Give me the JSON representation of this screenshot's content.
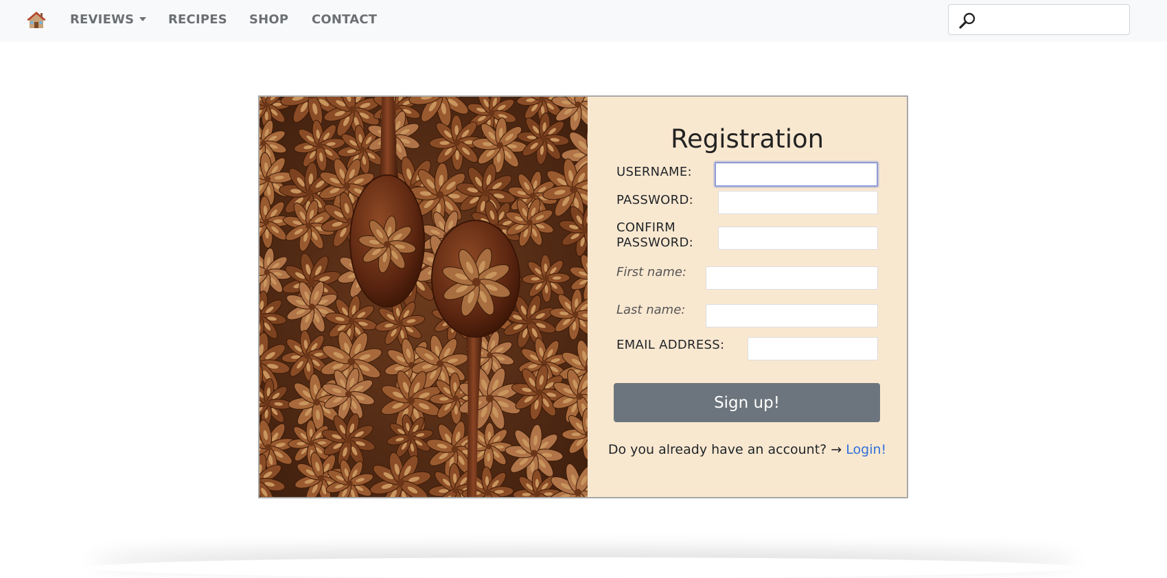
{
  "nav": {
    "home_icon": "house-icon",
    "items": [
      {
        "label": "REVIEWS",
        "has_dropdown": true
      },
      {
        "label": "RECIPES"
      },
      {
        "label": "SHOP"
      },
      {
        "label": "CONTACT"
      }
    ],
    "search": {
      "icon": "magnifier-icon",
      "value": "",
      "placeholder": ""
    }
  },
  "card": {
    "image": {
      "description_icon": "star-anise-photo"
    },
    "form": {
      "title": "Registration",
      "fields": {
        "username": {
          "label": "USERNAME:",
          "value": ""
        },
        "password": {
          "label": "PASSWORD:",
          "value": ""
        },
        "confirm_password": {
          "label_line1": "CONFIRM",
          "label_line2": "PASSWORD:",
          "value": ""
        },
        "first_name": {
          "label": "First name:",
          "value": ""
        },
        "last_name": {
          "label": "Last name:",
          "value": ""
        },
        "email": {
          "label": "EMAIL ADDRESS:",
          "value": ""
        }
      },
      "submit_label": "Sign up!",
      "login_prompt": "Do you already have an account? → ",
      "login_link": "Login!"
    }
  },
  "colors": {
    "navbar_bg": "#f8f9fa",
    "nav_text": "#6c6f73",
    "form_bg": "#f9e8d0",
    "button_bg": "#6c757d",
    "link": "#2f6fdb",
    "focus_border": "#8d9ad6"
  }
}
